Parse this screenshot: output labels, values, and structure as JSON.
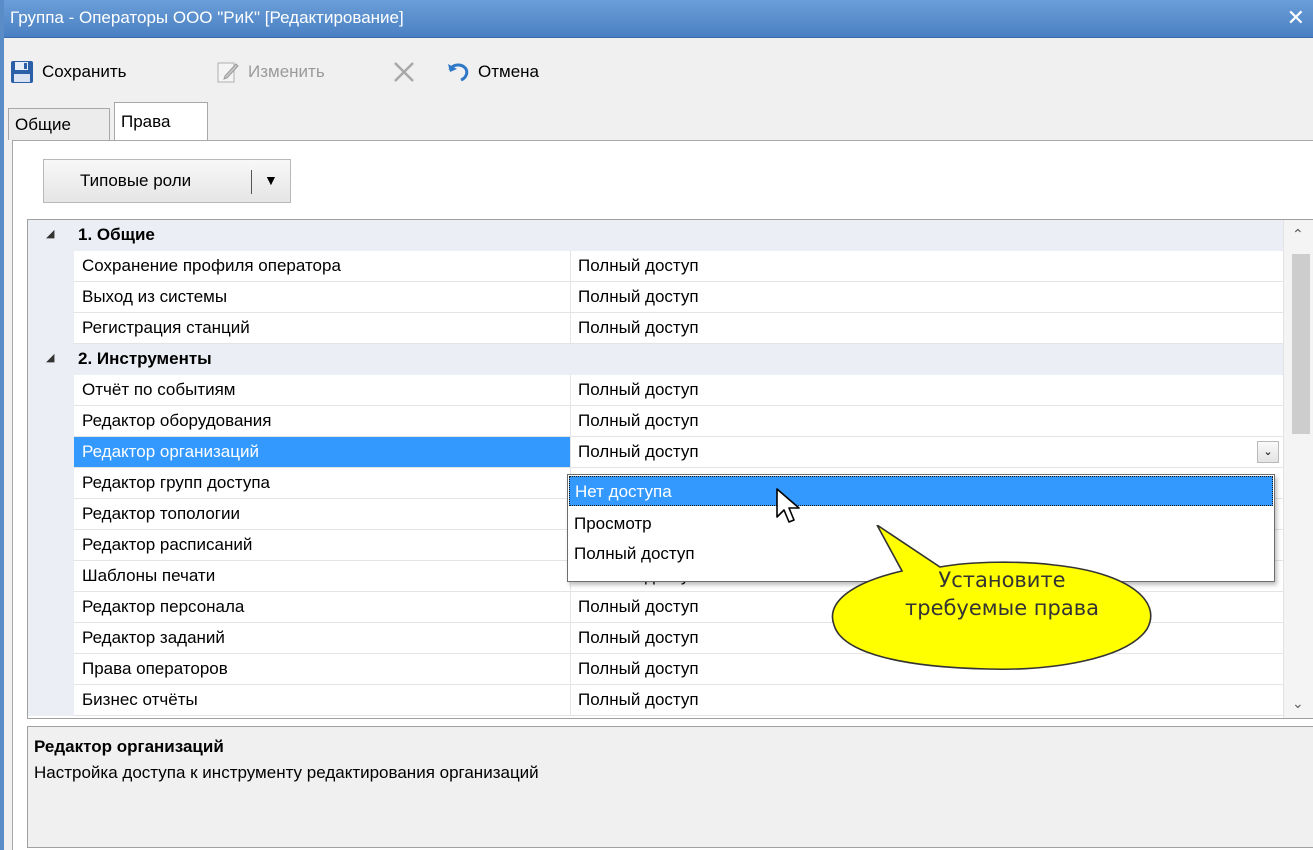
{
  "window": {
    "title": "Группа - Операторы ООО \"РиК\" [Редактирование]",
    "close_glyph": "✕",
    "accent_color": "#4a80c3"
  },
  "toolbar": {
    "save_label": "Сохранить",
    "edit_label": "Изменить",
    "cancel_label": "Отмена",
    "icons": [
      "floppy-disk-icon",
      "edit-pencil-icon",
      "delete-x-icon",
      "undo-arrow-icon"
    ],
    "edit_enabled": false,
    "delete_enabled": false
  },
  "tabs": [
    {
      "label": "Общие",
      "active": false
    },
    {
      "label": "Права",
      "active": true
    }
  ],
  "roles_button": {
    "label": "Типовые роли",
    "arrow": "▼"
  },
  "grid": {
    "rows": [
      {
        "type": "category",
        "label": "1. Общие",
        "expander": "◢"
      },
      {
        "type": "property",
        "name": "Сохранение профиля оператора",
        "value": "Полный доступ"
      },
      {
        "type": "property",
        "name": "Выход из системы",
        "value": "Полный доступ"
      },
      {
        "type": "property",
        "name": "Регистрация станций",
        "value": "Полный доступ"
      },
      {
        "type": "category",
        "label": "2. Инструменты",
        "expander": "◢"
      },
      {
        "type": "property",
        "name": "Отчёт по событиям",
        "value": "Полный доступ"
      },
      {
        "type": "property",
        "name": "Редактор оборудования",
        "value": "Полный доступ"
      },
      {
        "type": "property",
        "name": "Редактор организаций",
        "value": "Полный доступ",
        "selected": true
      },
      {
        "type": "property",
        "name": "Редактор групп доступа",
        "value": ""
      },
      {
        "type": "property",
        "name": "Редактор топологии",
        "value": ""
      },
      {
        "type": "property",
        "name": "Редактор расписаний",
        "value": ""
      },
      {
        "type": "property",
        "name": "Шаблоны печати",
        "value": "Полный доступ"
      },
      {
        "type": "property",
        "name": "Редактор персонала",
        "value": "Полный доступ"
      },
      {
        "type": "property",
        "name": "Редактор заданий",
        "value": "Полный доступ"
      },
      {
        "type": "property",
        "name": "Права операторов",
        "value": "Полный доступ"
      },
      {
        "type": "property",
        "name": "Бизнес отчёты",
        "value": "Полный доступ"
      }
    ],
    "dropdown_glyph": "⌄",
    "scroll_up_glyph": "⌃",
    "scroll_down_glyph": "⌄"
  },
  "dropdown": {
    "options": [
      "Нет доступа",
      "Просмотр",
      "Полный доступ"
    ],
    "hovered": "Нет доступа"
  },
  "callout": {
    "lines": [
      "Установите",
      "требуемые права"
    ],
    "fill_color": "#ffff00"
  },
  "description": {
    "title": "Редактор организаций",
    "text": "Настройка доступа к инструменту редактирования организаций"
  }
}
